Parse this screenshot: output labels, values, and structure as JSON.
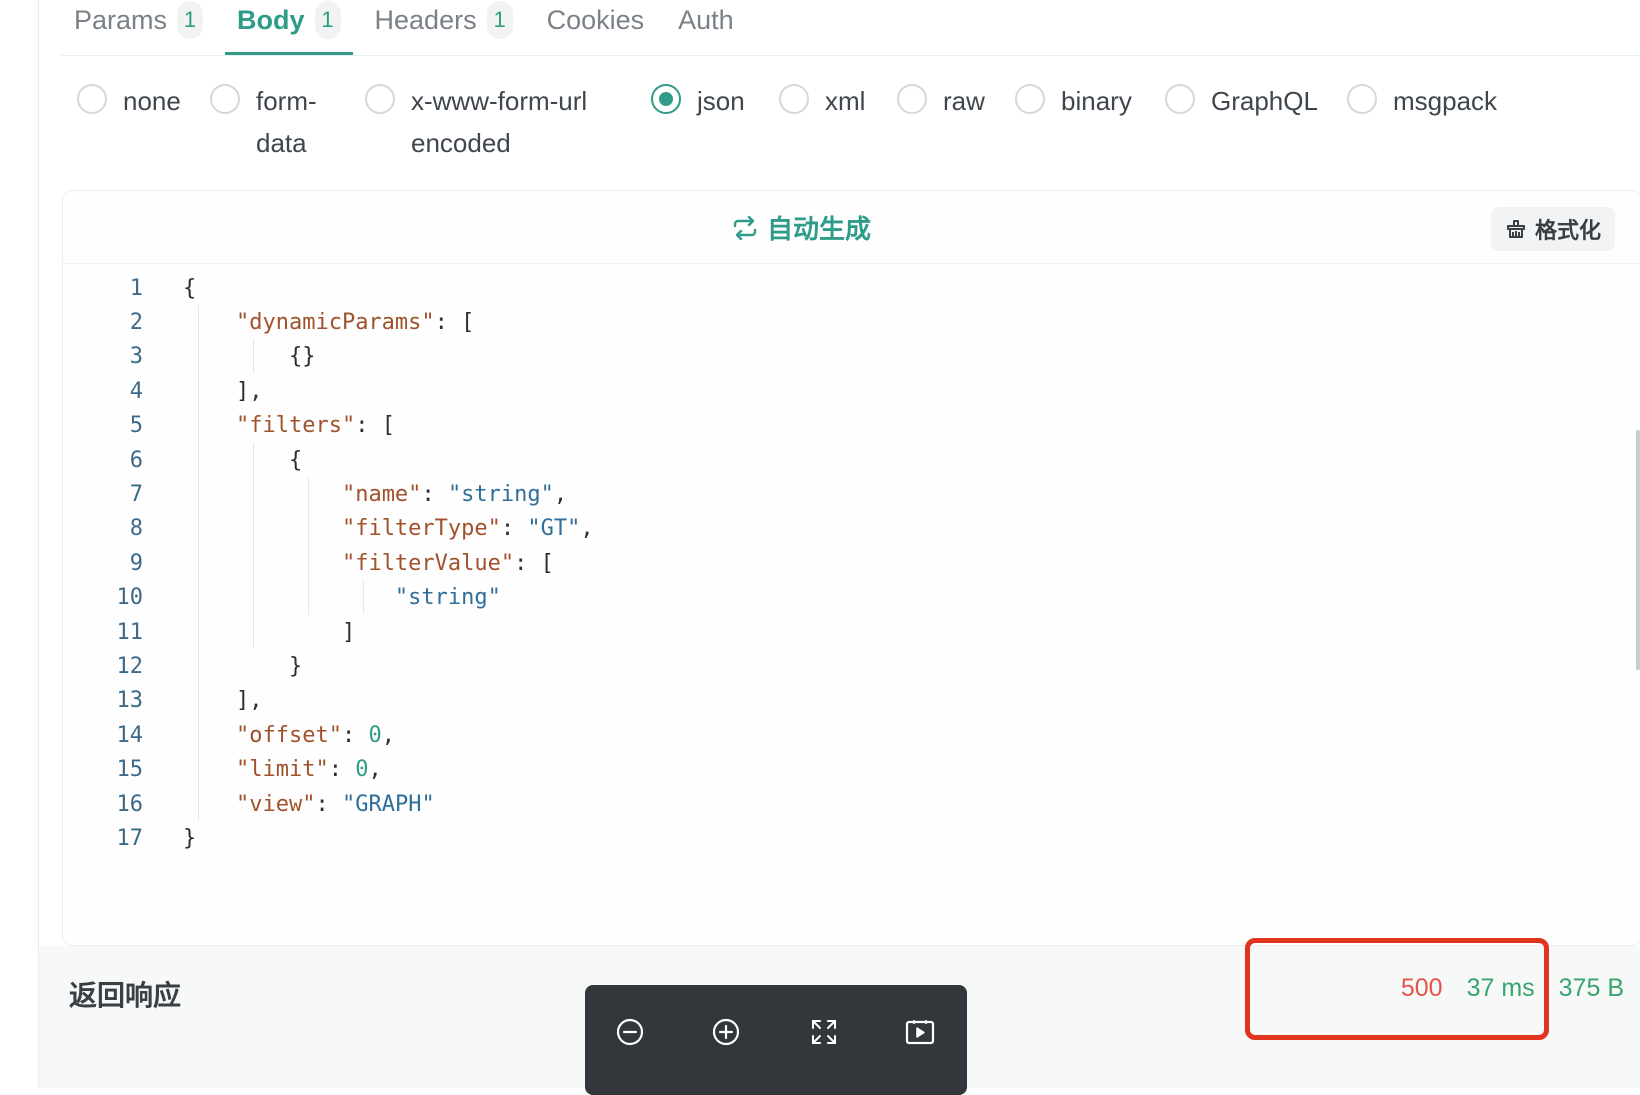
{
  "tabs": [
    {
      "label": "Params",
      "badge": "1"
    },
    {
      "label": "Body",
      "badge": "1"
    },
    {
      "label": "Headers",
      "badge": "1"
    },
    {
      "label": "Cookies"
    },
    {
      "label": "Auth"
    }
  ],
  "body_types": [
    {
      "label": "none",
      "checked": false
    },
    {
      "label": "form-data",
      "checked": false
    },
    {
      "label": "x-www-form-urlencoded",
      "checked": false
    },
    {
      "label": "json",
      "checked": true
    },
    {
      "label": "xml",
      "checked": false
    },
    {
      "label": "raw",
      "checked": false
    },
    {
      "label": "binary",
      "checked": false
    },
    {
      "label": "GraphQL",
      "checked": false
    },
    {
      "label": "msgpack",
      "checked": false
    }
  ],
  "editor": {
    "autogen_label": "自动生成",
    "format_label": "格式化",
    "lines": [
      "{",
      "    \"dynamicParams\": [",
      "        {}",
      "    ],",
      "    \"filters\": [",
      "        {",
      "            \"name\": \"string\",",
      "            \"filterType\": \"GT\",",
      "            \"filterValue\": [",
      "                \"string\"",
      "            ]",
      "        }",
      "    ],",
      "    \"offset\": 0,",
      "    \"limit\": 0,",
      "    \"view\": \"GRAPH\"",
      "}"
    ]
  },
  "response": {
    "title": "返回响应",
    "status_code": "500",
    "time": "37 ms",
    "size": "375 B"
  },
  "colors": {
    "accent": "#2f9c89",
    "error": "#e5544a",
    "success": "#38a56f",
    "highlight_box": "#e0341f"
  },
  "float_toolbar": {
    "icons": [
      "zoom-out-icon",
      "zoom-in-icon",
      "fullscreen-icon",
      "play-icon"
    ]
  }
}
